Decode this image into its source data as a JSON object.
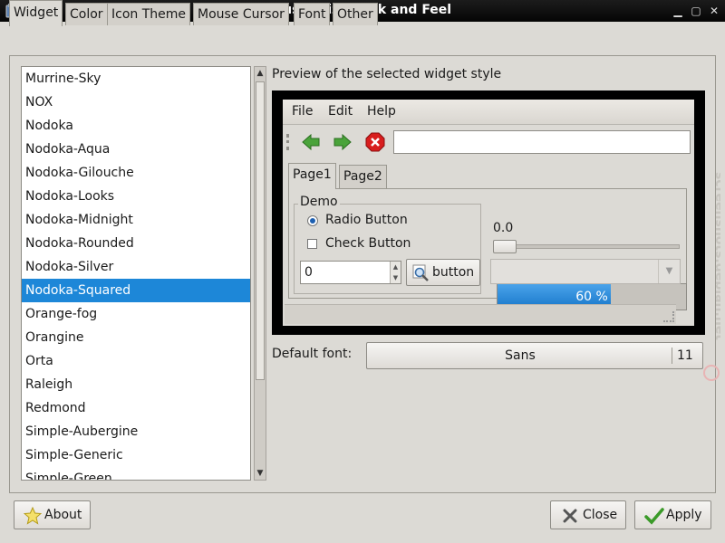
{
  "window": {
    "title": "Customize Look and Feel"
  },
  "tabs": [
    {
      "label": "Widget",
      "active": true
    },
    {
      "label": "Color"
    },
    {
      "label": "Icon Theme"
    },
    {
      "label": "Mouse Cursor"
    },
    {
      "label": "Font"
    },
    {
      "label": "Other"
    }
  ],
  "themes": {
    "selected": "Nodoka-Squared",
    "items": [
      "Murrine-Sky",
      "NOX",
      "Nodoka",
      "Nodoka-Aqua",
      "Nodoka-Gilouche",
      "Nodoka-Looks",
      "Nodoka-Midnight",
      "Nodoka-Rounded",
      "Nodoka-Silver",
      "Nodoka-Squared",
      "Orange-fog",
      "Orangine",
      "Orta",
      "Raleigh",
      "Redmond",
      "Simple-Aubergine",
      "Simple-Generic",
      "Simple-Green"
    ]
  },
  "preview": {
    "label": "Preview of the selected widget style",
    "menu": {
      "file": "File",
      "edit": "Edit",
      "help": "Help"
    },
    "tabs": {
      "page1": "Page1",
      "page2": "Page2"
    },
    "demo": {
      "legend": "Demo",
      "radio": "Radio Button",
      "radio_checked": true,
      "check": "Check Button",
      "check_checked": false,
      "spin_value": "0",
      "button": "button"
    },
    "progress": {
      "value": 60,
      "text": "60 %"
    },
    "scale_value": "0.0"
  },
  "font": {
    "label": "Default font:",
    "name": "Sans",
    "size": "11"
  },
  "buttons": {
    "about": "About",
    "close": "Close",
    "apply": "Apply"
  },
  "colors": {
    "selection": "#1d87d8",
    "titlebar": "#0a0a0a",
    "window_bg": "#dcdad5"
  },
  "watermark": "screenshots.debian.net"
}
